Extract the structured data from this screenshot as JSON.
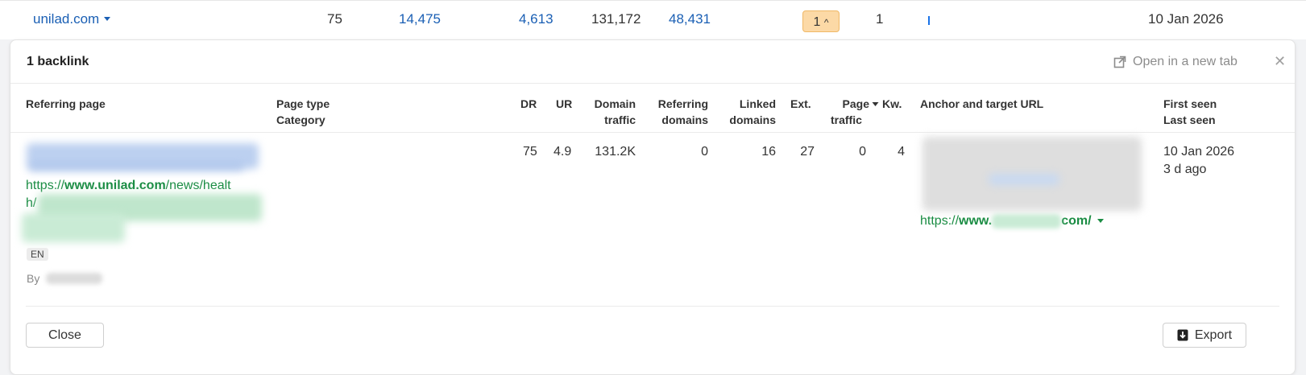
{
  "top_row": {
    "domain": "unilad.com",
    "dr": "75",
    "v1": "14,475",
    "v2": "4,613",
    "v3": "131,172",
    "v4": "48,431",
    "badge": "1",
    "count": "1",
    "date": "10 Jan 2026"
  },
  "panel": {
    "title": "1 backlink",
    "open_new_tab": "Open in a new tab"
  },
  "headers": {
    "referring_page": "Referring page",
    "page_type": "Page type",
    "category": "Category",
    "dr": "DR",
    "ur": "UR",
    "domain_traffic_1": "Domain",
    "domain_traffic_2": "traffic",
    "referring_domains_1": "Referring",
    "referring_domains_2": "domains",
    "linked_domains_1": "Linked",
    "linked_domains_2": "domains",
    "ext": "Ext.",
    "page_traffic_1": "Page",
    "page_traffic_2": "traffic",
    "kw": "Kw.",
    "anchor": "Anchor and target URL",
    "first_seen": "First seen",
    "last_seen": "Last seen"
  },
  "row": {
    "url_prefix": "https://",
    "url_domain": "www.unilad.com",
    "url_path_1": "/news/healt",
    "url_path_2": "h/",
    "lang": "EN",
    "by": "By",
    "dr": "75",
    "ur": "4.9",
    "domain_traffic": "131.2K",
    "referring_domains": "0",
    "linked_domains": "16",
    "ext": "27",
    "page_traffic": "0",
    "kw": "4",
    "target_prefix": "https://",
    "target_www": "www.",
    "target_tld": "com/",
    "first_seen": "10 Jan 2026",
    "last_seen": "3 d ago"
  },
  "buttons": {
    "close": "Close",
    "export": "Export"
  },
  "icons": {
    "dropdown": "caret-down-icon",
    "badge_arrow": "chevron-up-icon",
    "external_link": "external-link-icon",
    "close": "close-icon",
    "sort": "sort-desc-icon",
    "export": "download-icon"
  },
  "colors": {
    "link": "#1a5fb4",
    "url_green": "#1a8c43",
    "badge_bg": "#fcd9a6"
  }
}
